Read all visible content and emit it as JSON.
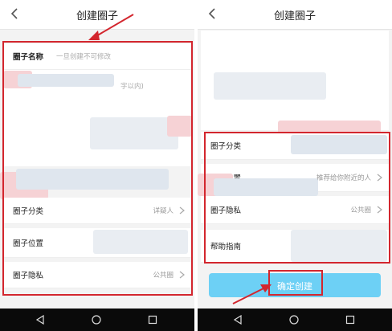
{
  "panel_left": {
    "title": "创建圈子",
    "name_label": "圈子名称",
    "name_placeholder": "一旦创建不可修改",
    "desc_placeholder_tail": "字以内)",
    "category_label": "圈子分类",
    "category_value": "详疑人",
    "location_label": "圈子位置",
    "privacy_label": "圈子隐私",
    "privacy_value": "公共圈"
  },
  "panel_right": {
    "title": "创建圈子",
    "category_label": "圈子分类",
    "location_label": "圈子位置",
    "location_value": "推荐给你附近的人",
    "privacy_label": "圈子隐私",
    "privacy_value": "公共圈",
    "help_label": "帮助指南",
    "create_button": "确定创建"
  },
  "colors": {
    "highlight": "#d3262e",
    "button": "#6dd0f5",
    "navbar": "#0a0a0a"
  },
  "icons": [
    "back-icon",
    "chevron-right-icon",
    "nav-back-icon",
    "nav-home-icon",
    "nav-recent-icon"
  ]
}
